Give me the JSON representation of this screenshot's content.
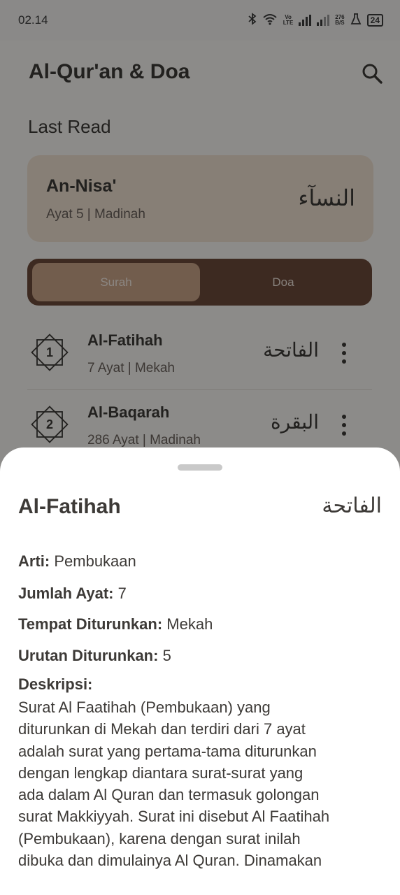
{
  "status_bar": {
    "time": "02.14",
    "network_speed_value": "276",
    "network_speed_unit": "B/S",
    "volte_top": "Vo",
    "volte_bottom": "LTE",
    "battery": "24"
  },
  "app": {
    "title": "Al-Qur'an & Doa",
    "last_read_heading": "Last Read",
    "last_read": {
      "name": "An-Nisa'",
      "meta": "Ayat 5 | Madinah",
      "arabic": "النسآء"
    },
    "tabs": [
      {
        "label": "Surah",
        "selected": true
      },
      {
        "label": "Doa",
        "selected": false
      }
    ],
    "surah_list": [
      {
        "number": "1",
        "name": "Al-Fatihah",
        "meta": "7 Ayat | Mekah",
        "arabic": "الفاتحة"
      },
      {
        "number": "2",
        "name": "Al-Baqarah",
        "meta": "286 Ayat | Madinah",
        "arabic": "البقرة"
      }
    ]
  },
  "sheet": {
    "title": "Al-Fatihah",
    "arabic": "الفاتحة",
    "fields": [
      {
        "label": "Arti:",
        "value": "Pembukaan"
      },
      {
        "label": "Jumlah Ayat:",
        "value": "7"
      },
      {
        "label": "Tempat Diturunkan:",
        "value": "Mekah"
      },
      {
        "label": "Urutan Diturunkan:",
        "value": "5"
      }
    ],
    "description_label": "Deskripsi:",
    "description": "Surat Al Faatihah (Pembukaan) yang\nditurunkan di Mekah dan terdiri dari 7 ayat\nadalah surat yang pertama-tama diturunkan\ndengan lengkap  diantara surat-surat yang\nada dalam Al Quran dan termasuk golongan\nsurat Makkiyyah. Surat ini disebut Al Faatihah\n(Pembukaan), karena dengan surat inilah\ndibuka dan dimulainya Al Quran. Dinamakan"
  },
  "colors": {
    "card_bg": "#eedfd0",
    "tab_bar_bg": "#6b4a3a",
    "tab_selected_bg": "#c9a488",
    "text_dark": "#3d3a37"
  }
}
